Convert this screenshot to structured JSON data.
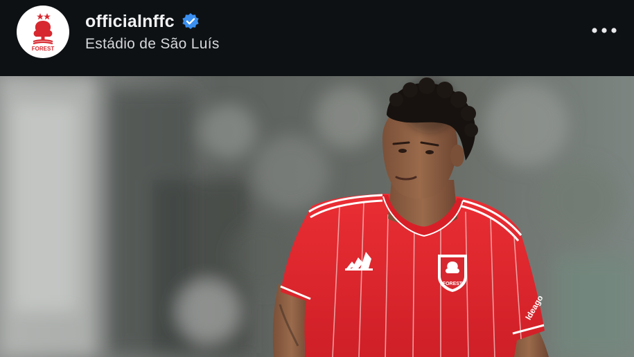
{
  "account": {
    "username": "officialnffc",
    "verified": true,
    "location": "Estádio de São Luís",
    "avatar_icon": "nottingham-forest-crest-icon",
    "avatar_text": "FOREST"
  },
  "header": {
    "more_icon": "more-options-icon"
  },
  "photo": {
    "subject": "footballer-in-red-kit",
    "kit_sponsor_text": "Ideago",
    "crest_text": "FOREST"
  },
  "colors": {
    "header_bg": "#0e1114",
    "username": "#f2f3f5",
    "location": "#d6d8db",
    "verified_badge": "#3a8ff0",
    "brand_red": "#d7282f",
    "kit_red": "#e0262d"
  }
}
